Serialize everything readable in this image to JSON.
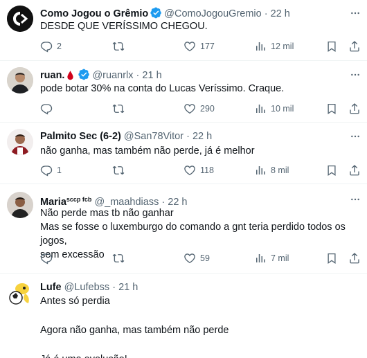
{
  "tweets": [
    {
      "name": "Como Jogou o Grêmio",
      "handle": "@ComoJogouGremio",
      "dot": "·",
      "time": "22 h",
      "verified": true,
      "lines": "DESDE QUE VERÍSSIMO CHEGOU.",
      "replies": "2",
      "retweets": "",
      "likes": "177",
      "views": "12 mil"
    },
    {
      "name": "ruan.",
      "handle": "@ruanrlx",
      "dot": "·",
      "time": "21 h",
      "verified": true,
      "lines": "pode botar 30% na conta do Lucas Veríssimo. Craque.",
      "replies": "",
      "retweets": "",
      "likes": "290",
      "views": "10 mil"
    },
    {
      "name": "Palmito Sec (6-2)",
      "handle": "@San78Vitor",
      "dot": "·",
      "time": "22 h",
      "verified": false,
      "lines": "não ganha, mas também não perde, já é melhor",
      "replies": "1",
      "retweets": "",
      "likes": "118",
      "views": "8 mil"
    },
    {
      "name": "Maria",
      "name_sup": "sccp fcb",
      "handle": "@_maahdiass",
      "dot": "·",
      "time": "22 h",
      "verified": false,
      "lines": "Não perde mas tb não ganhar\nMas se fosse o luxemburgo do comando a gnt teria perdido todos os jogos,\nsem excessão",
      "replies": "",
      "retweets": "",
      "likes": "59",
      "views": "7 mil"
    },
    {
      "name": "Lufe",
      "handle": "@Lufebss",
      "dot": "·",
      "time": "21 h",
      "verified": false,
      "lines": "Antes só perdia\n\nAgora não ganha, mas também não perde\n\nJá é uma evolução!"
    }
  ],
  "icons": {
    "reply": "reply-icon",
    "retweet": "retweet-icon",
    "like": "heart-icon",
    "views": "views-icon",
    "bookmark": "bookmark-icon",
    "share": "share-icon",
    "more": "more-icon",
    "verified": "verified-badge-icon",
    "blood_drop": "blood-drop-icon"
  },
  "colors": {
    "verified": "#1d9bf0",
    "text": "#0f1419",
    "muted": "#536471",
    "blood_drop": "#d0021b"
  }
}
